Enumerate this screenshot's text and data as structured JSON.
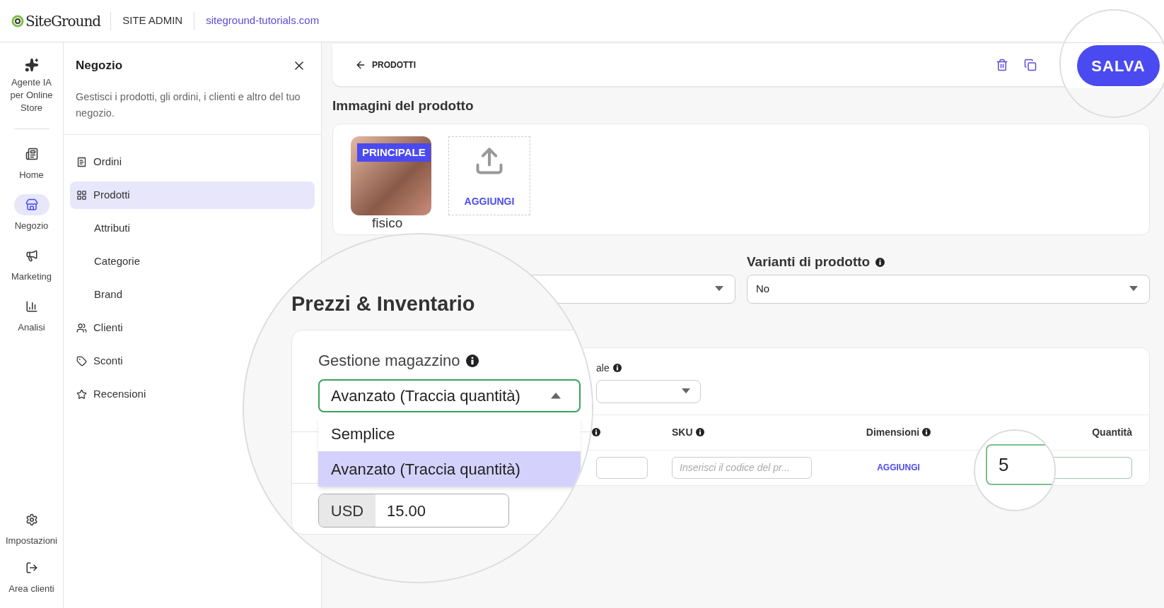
{
  "top_bar": {
    "logo": "SiteGround",
    "section": "SITE ADMIN",
    "domain": "siteground-tutorials.com"
  },
  "rail": {
    "top_items": [
      {
        "label": "Agente IA per Online Store",
        "selected": false
      }
    ],
    "items": [
      {
        "label": "Home",
        "selected": false
      },
      {
        "label": "Negozio",
        "selected": true
      },
      {
        "label": "Marketing",
        "selected": false
      },
      {
        "label": "Analisi",
        "selected": false
      }
    ],
    "bottom_items": [
      {
        "label": "Impostazioni",
        "selected": false
      },
      {
        "label": "Area clienti",
        "selected": false
      }
    ]
  },
  "sidebar": {
    "title": "Negozio",
    "description": "Gestisci i prodotti, gli ordini, i clienti e altro del tuo negozio.",
    "items": [
      {
        "label": "Ordini",
        "selected": false
      },
      {
        "label": "Prodotti",
        "selected": true,
        "children": [
          {
            "label": "Attributi",
            "selected": false
          },
          {
            "label": "Categorie",
            "selected": false
          },
          {
            "label": "Brand",
            "selected": false
          }
        ]
      },
      {
        "label": "Clienti",
        "selected": false
      },
      {
        "label": "Sconti",
        "selected": false
      },
      {
        "label": "Recensioni",
        "selected": false
      }
    ]
  },
  "header": {
    "back_link": "PRODOTTI",
    "save_button": "SALVA"
  },
  "images": {
    "title": "Immagini del prodotto",
    "badge": "PRINCIPALE",
    "add_button": "AGGIUNGI"
  },
  "product_type_fragment": "fisico",
  "variants": {
    "label": "Varianti di prodotto",
    "value": "No"
  },
  "inventory": {
    "field_label_fragment": "ale",
    "columns": [
      {
        "label": "SKU",
        "info": true
      },
      {
        "label": "Dimensioni",
        "info": true
      },
      {
        "label": "Quantità",
        "info": false
      }
    ],
    "row": {
      "sku_placeholder": "Inserisci il codice del pr...",
      "dimensions_link": "AGGIUNGI",
      "quantity": "5"
    }
  },
  "magnifier": {
    "heading": "Prezzi & Inventario",
    "stock_label": "Gestione magazzino",
    "stock_value": "Avanzato (Traccia quantità)",
    "expanded": true,
    "options": [
      {
        "label": "Semplice",
        "selected": false
      },
      {
        "label": "Avanzato (Traccia quantità)",
        "selected": true
      }
    ],
    "currency": "USD",
    "price": "15.00"
  }
}
